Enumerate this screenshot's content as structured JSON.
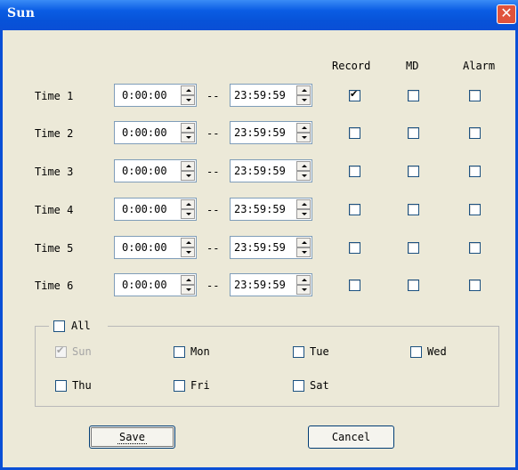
{
  "window": {
    "title": "Sun",
    "close_glyph": "✕"
  },
  "headers": {
    "record": "Record",
    "md": "MD",
    "alarm": "Alarm"
  },
  "separator": "--",
  "rows": [
    {
      "label": "Time 1",
      "start": "0:00:00",
      "end": "23:59:59",
      "record": true,
      "md": false,
      "alarm": false
    },
    {
      "label": "Time 2",
      "start": "0:00:00",
      "end": "23:59:59",
      "record": false,
      "md": false,
      "alarm": false
    },
    {
      "label": "Time 3",
      "start": "0:00:00",
      "end": "23:59:59",
      "record": false,
      "md": false,
      "alarm": false
    },
    {
      "label": "Time 4",
      "start": "0:00:00",
      "end": "23:59:59",
      "record": false,
      "md": false,
      "alarm": false
    },
    {
      "label": "Time 5",
      "start": "0:00:00",
      "end": "23:59:59",
      "record": false,
      "md": false,
      "alarm": false
    },
    {
      "label": "Time 6",
      "start": "0:00:00",
      "end": "23:59:59",
      "record": false,
      "md": false,
      "alarm": false
    }
  ],
  "days": {
    "all": {
      "label": "All",
      "checked": false
    },
    "items": [
      {
        "label": "Sun",
        "checked": true,
        "disabled": true
      },
      {
        "label": "Mon",
        "checked": false,
        "disabled": false
      },
      {
        "label": "Tue",
        "checked": false,
        "disabled": false
      },
      {
        "label": "Wed",
        "checked": false,
        "disabled": false
      },
      {
        "label": "Thu",
        "checked": false,
        "disabled": false
      },
      {
        "label": "Fri",
        "checked": false,
        "disabled": false
      },
      {
        "label": "Sat",
        "checked": false,
        "disabled": false
      }
    ]
  },
  "buttons": {
    "save": "Save",
    "cancel": "Cancel"
  }
}
